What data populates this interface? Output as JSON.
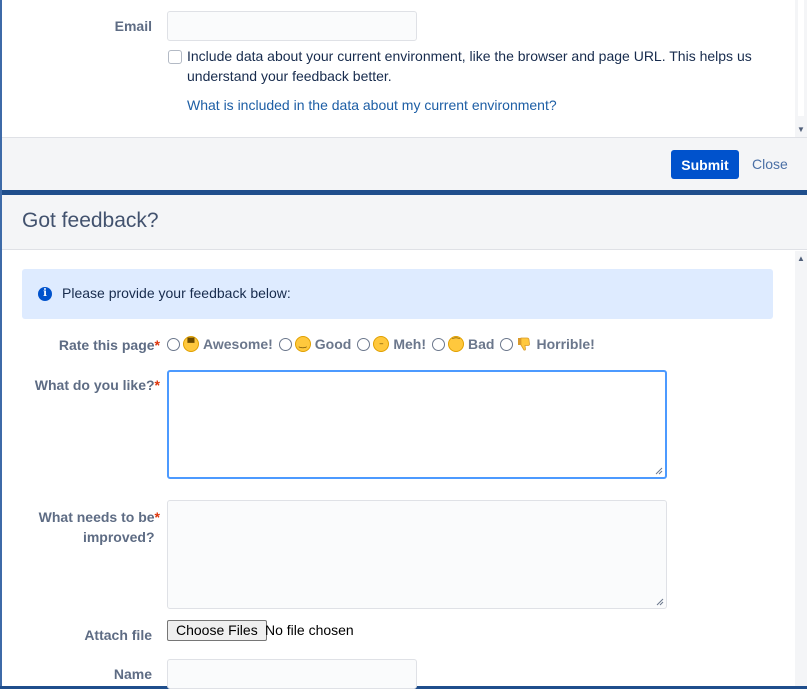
{
  "back_dialog": {
    "email_label": "Email",
    "email_value": "",
    "env_checkbox_text": "Include data about your current environment, like the browser and page URL. This helps us understand your feedback better.",
    "env_link": "What is included in the data about my current environment?",
    "submit_label": "Submit",
    "close_label": "Close"
  },
  "feedback_dialog": {
    "title": "Got feedback?",
    "info_text": "Please provide your feedback below:",
    "rate_label": "Rate this page",
    "rating_options": [
      {
        "label": "Awesome!",
        "icon": "grinning-face-icon"
      },
      {
        "label": "Good",
        "icon": "slightly-smiling-face-icon"
      },
      {
        "label": "Meh!",
        "icon": "neutral-face-icon"
      },
      {
        "label": "Bad",
        "icon": "frowning-face-icon"
      },
      {
        "label": "Horrible!",
        "icon": "thumbs-down-icon"
      }
    ],
    "like_label": "What do you like?",
    "like_value": "",
    "improve_label": "What needs to be improved?",
    "improve_value": "",
    "attach_label": "Attach file",
    "choose_files_label": "Choose Files",
    "file_status": "No file chosen",
    "name_label": "Name",
    "name_value": "",
    "required_marker": "*"
  },
  "colors": {
    "primary": "#0052cc",
    "link": "#1d5ea5",
    "info_bg": "#deebff",
    "focus_border": "#4c9aff",
    "required": "#de350b"
  }
}
